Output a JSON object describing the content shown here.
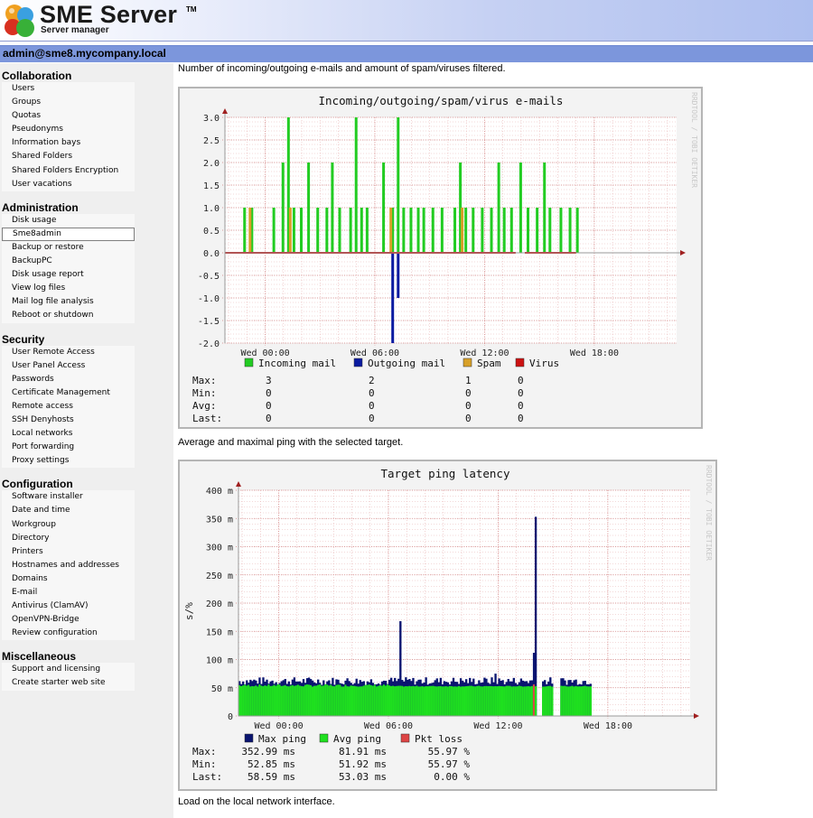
{
  "header": {
    "title": "SME Server",
    "trademark": "TM",
    "subtitle": "Server manager"
  },
  "user": "admin@sme8.mycompany.local",
  "sidebar": {
    "sections": [
      {
        "heading": "Collaboration",
        "items": [
          "Users",
          "Groups",
          "Quotas",
          "Pseudonyms",
          "Information bays",
          "Shared Folders",
          "Shared Folders Encryption",
          "User vacations"
        ]
      },
      {
        "heading": "Administration",
        "items": [
          "Disk usage",
          "Sme8admin",
          "Backup or restore",
          "BackupPC",
          "Disk usage report",
          "View log files",
          "Mail log file analysis",
          "Reboot or shutdown"
        ]
      },
      {
        "heading": "Security",
        "items": [
          "User Remote Access",
          "User Panel Access",
          "Passwords",
          "Certificate Management",
          "Remote access",
          "SSH Denyhosts",
          "Local networks",
          "Port forwarding",
          "Proxy settings"
        ]
      },
      {
        "heading": "Configuration",
        "items": [
          "Software installer",
          "Date and time",
          "Workgroup",
          "Directory",
          "Printers",
          "Hostnames and addresses",
          "Domains",
          "E-mail",
          "Antivirus (ClamAV)",
          "OpenVPN-Bridge",
          "Review configuration"
        ]
      },
      {
        "heading": "Miscellaneous",
        "items": [
          "Support and licensing",
          "Create starter web site"
        ]
      }
    ],
    "active_item": "Sme8admin"
  },
  "main": {
    "desc1": "Number of incoming/outgoing e-mails and amount of spam/viruses filtered.",
    "desc2": "Average and maximal ping with the selected target.",
    "desc3": "Load on the local network interface."
  },
  "watermark": "RRDTOOL / TOBI OETIKER",
  "chart_data": [
    {
      "type": "bar",
      "title": "Incoming/outgoing/spam/virus e-mails",
      "ylabel": "",
      "ylim": [
        -2.0,
        3.0
      ],
      "y_ticks": [
        "3.0",
        "2.5",
        "2.0",
        "1.5",
        "1.0",
        "0.5",
        "0.0",
        "-0.5",
        "-1.0",
        "-1.5",
        "-2.0"
      ],
      "x_ticks": [
        "Wed 00:00",
        "Wed 06:00",
        "Wed 12:00",
        "Wed 18:00"
      ],
      "x_tick_hours": [
        0,
        6,
        12,
        18
      ],
      "x_range_hours": [
        -2.2,
        22.5
      ],
      "colors": {
        "incoming": "#22cc22",
        "outgoing": "#0a1aa0",
        "spam": "#d8a028",
        "virus": "#cc1111"
      },
      "series": [
        {
          "name": "Incoming mail",
          "color": "#22cc22",
          "points": [
            [
              -1.2,
              1
            ],
            [
              -0.8,
              1
            ],
            [
              0.4,
              1
            ],
            [
              0.9,
              2
            ],
            [
              1.2,
              3
            ],
            [
              1.5,
              1
            ],
            [
              1.9,
              1
            ],
            [
              2.3,
              2
            ],
            [
              2.8,
              1
            ],
            [
              3.3,
              1
            ],
            [
              3.6,
              2
            ],
            [
              4.0,
              1
            ],
            [
              4.6,
              1
            ],
            [
              4.9,
              3
            ],
            [
              5.2,
              1
            ],
            [
              5.5,
              1
            ],
            [
              6.4,
              2
            ],
            [
              6.9,
              1
            ],
            [
              7.2,
              3
            ],
            [
              7.5,
              1
            ],
            [
              7.9,
              1
            ],
            [
              8.3,
              1
            ],
            [
              8.6,
              1
            ],
            [
              9.1,
              1
            ],
            [
              9.6,
              1
            ],
            [
              10.3,
              1
            ],
            [
              10.6,
              2
            ],
            [
              10.9,
              1
            ],
            [
              11.3,
              1
            ],
            [
              11.8,
              1
            ],
            [
              12.3,
              1
            ],
            [
              12.7,
              2
            ],
            [
              13.0,
              1
            ],
            [
              13.4,
              1
            ],
            [
              13.9,
              2
            ],
            [
              14.3,
              1
            ],
            [
              14.8,
              1
            ],
            [
              15.2,
              2
            ],
            [
              15.5,
              1
            ],
            [
              16.1,
              1
            ],
            [
              16.6,
              1
            ],
            [
              17.0,
              1
            ]
          ]
        },
        {
          "name": "Outgoing mail",
          "color": "#0a1aa0",
          "points": [
            [
              6.9,
              -2
            ],
            [
              7.2,
              -1
            ]
          ]
        },
        {
          "name": "Spam",
          "color": "#d8a028",
          "points": [
            [
              -0.9,
              1
            ],
            [
              1.3,
              1
            ],
            [
              6.8,
              1
            ],
            [
              10.7,
              1
            ]
          ]
        },
        {
          "name": "Virus",
          "color": "#cc1111",
          "points": []
        }
      ],
      "legend": [
        {
          "name": "Incoming mail",
          "color": "#22cc22"
        },
        {
          "name": "Outgoing mail",
          "color": "#0a1aa0"
        },
        {
          "name": "Spam",
          "color": "#d8a028"
        },
        {
          "name": "Virus",
          "color": "#cc1111"
        }
      ],
      "stats": [
        {
          "label": "Max:",
          "values": [
            "3",
            "2",
            "1",
            "0"
          ]
        },
        {
          "label": "Min:",
          "values": [
            "0",
            "0",
            "0",
            "0"
          ]
        },
        {
          "label": "Avg:",
          "values": [
            "0",
            "0",
            "0",
            "0"
          ]
        },
        {
          "label": "Last:",
          "values": [
            "0",
            "0",
            "0",
            "0"
          ]
        }
      ]
    },
    {
      "type": "area",
      "title": "Target ping latency",
      "ylabel": "s/%",
      "ylim": [
        0,
        400
      ],
      "y_ticks": [
        "400 m",
        "350 m",
        "300 m",
        "250 m",
        "200 m",
        "150 m",
        "100 m",
        "50 m",
        "0"
      ],
      "x_ticks": [
        "Wed 00:00",
        "Wed 06:00",
        "Wed 12:00",
        "Wed 18:00"
      ],
      "x_tick_hours": [
        0,
        6,
        12,
        18
      ],
      "x_range_hours": [
        -2.2,
        22.5
      ],
      "data_end_hour": 17.0,
      "gaps_hours": [
        [
          14.0,
          14.3
        ],
        [
          14.9,
          15.3
        ]
      ],
      "avg_level_ms": 52,
      "max_base_ms": 58,
      "max_spikes": [
        [
          6.6,
          168
        ],
        [
          11.8,
          75
        ],
        [
          13.9,
          112
        ],
        [
          14.0,
          352.99
        ]
      ],
      "loss_spikes": [
        [
          13.9,
          55.97
        ]
      ],
      "series": [
        {
          "name": "Max ping",
          "color": "#0a1470"
        },
        {
          "name": "Avg ping",
          "color": "#1fe01f"
        },
        {
          "name": "Pkt loss",
          "color": "#dd4444"
        }
      ],
      "legend": [
        {
          "name": "Max ping",
          "color": "#0a1470"
        },
        {
          "name": "Avg ping",
          "color": "#1fe01f"
        },
        {
          "name": "Pkt loss",
          "color": "#dd4444"
        }
      ],
      "stats": [
        {
          "label": "Max:",
          "values": [
            "352.99 ms",
            "81.91 ms",
            "55.97 %"
          ]
        },
        {
          "label": "Min:",
          "values": [
            "52.85 ms",
            "51.92 ms",
            "55.97 %"
          ]
        },
        {
          "label": "Last:",
          "values": [
            "58.59 ms",
            "53.03 ms",
            "0.00 %"
          ]
        }
      ]
    }
  ]
}
